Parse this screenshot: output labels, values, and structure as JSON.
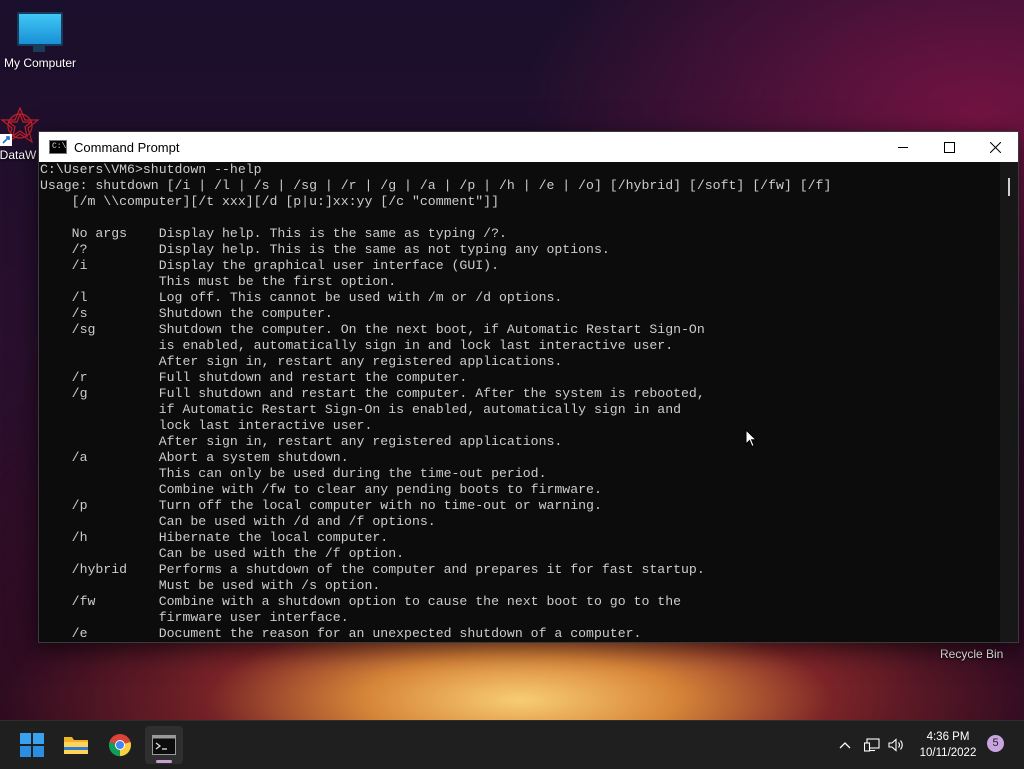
{
  "desktop": {
    "icons": [
      {
        "label": "My Computer",
        "icon": "monitor-icon"
      },
      {
        "label": "DataW",
        "icon": "datawrapper-icon"
      },
      {
        "label": "Recycle Bin",
        "icon": "recycle-bin-icon"
      }
    ]
  },
  "window": {
    "title": "Command Prompt",
    "icon": "cmd-icon",
    "controls": [
      "minimize-icon",
      "maximize-icon",
      "close-icon"
    ],
    "console_lines": [
      "C:\\Users\\VM6>shutdown --help",
      "Usage: shutdown [/i | /l | /s | /sg | /r | /g | /a | /p | /h | /e | /o] [/hybrid] [/soft] [/fw] [/f]",
      "    [/m \\\\computer][/t xxx][/d [p|u:]xx:yy [/c \"comment\"]]",
      "",
      "    No args    Display help. This is the same as typing /?.",
      "    /?         Display help. This is the same as not typing any options.",
      "    /i         Display the graphical user interface (GUI).",
      "               This must be the first option.",
      "    /l         Log off. This cannot be used with /m or /d options.",
      "    /s         Shutdown the computer.",
      "    /sg        Shutdown the computer. On the next boot, if Automatic Restart Sign-On",
      "               is enabled, automatically sign in and lock last interactive user.",
      "               After sign in, restart any registered applications.",
      "    /r         Full shutdown and restart the computer.",
      "    /g         Full shutdown and restart the computer. After the system is rebooted,",
      "               if Automatic Restart Sign-On is enabled, automatically sign in and",
      "               lock last interactive user.",
      "               After sign in, restart any registered applications.",
      "    /a         Abort a system shutdown.",
      "               This can only be used during the time-out period.",
      "               Combine with /fw to clear any pending boots to firmware.",
      "    /p         Turn off the local computer with no time-out or warning.",
      "               Can be used with /d and /f options.",
      "    /h         Hibernate the local computer.",
      "               Can be used with the /f option.",
      "    /hybrid    Performs a shutdown of the computer and prepares it for fast startup.",
      "               Must be used with /s option.",
      "    /fw        Combine with a shutdown option to cause the next boot to go to the",
      "               firmware user interface.",
      "    /e         Document the reason for an unexpected shutdown of a computer."
    ]
  },
  "taskbar": {
    "apps": [
      {
        "name": "start",
        "icon": "windows-start-icon"
      },
      {
        "name": "file-explorer",
        "icon": "folder-icon"
      },
      {
        "name": "chrome",
        "icon": "chrome-icon"
      },
      {
        "name": "command-prompt",
        "icon": "cmd-icon",
        "active": true
      }
    ],
    "tray_icons": [
      "chevron-up-icon",
      "network-icon",
      "volume-icon"
    ],
    "time": "4:36 PM",
    "date": "10/11/2022",
    "notification_count": "5"
  },
  "colors": {
    "console_bg": "#0c0c0c",
    "console_text": "#cccccc",
    "taskbar_bg": "#1f1f1f",
    "titlebar_bg": "#ffffff",
    "badge": "#c9a4e0"
  }
}
